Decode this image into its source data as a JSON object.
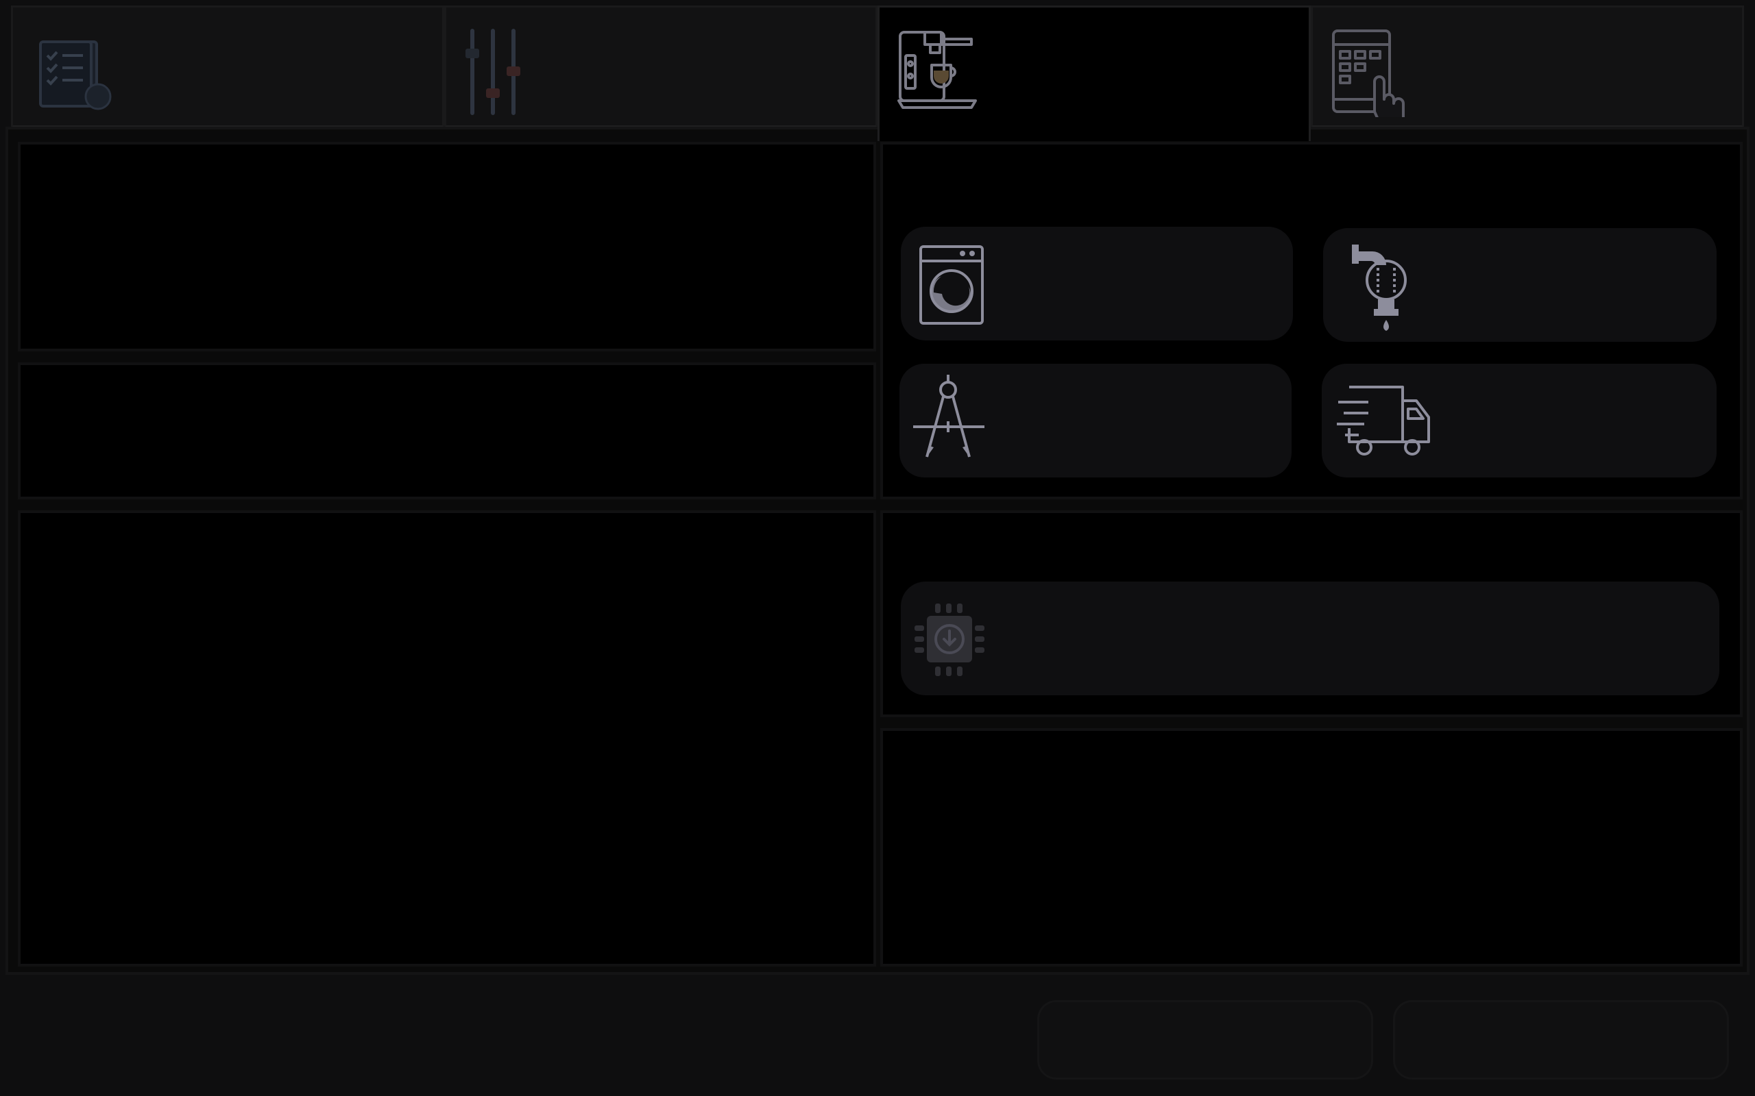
{
  "tabs": [
    {
      "icon": "checklist-document-icon",
      "active": false
    },
    {
      "icon": "sliders-icon",
      "active": false
    },
    {
      "icon": "coffee-machine-icon",
      "active": true
    },
    {
      "icon": "touch-screen-keypad-icon",
      "active": false
    }
  ],
  "sections": {
    "appliances": {
      "tiles": [
        {
          "icon": "washing-machine-icon"
        },
        {
          "icon": "water-filter-icon"
        },
        {
          "icon": "drafting-compass-icon"
        },
        {
          "icon": "delivery-truck-icon"
        }
      ]
    },
    "firmware": {
      "tiles": [
        {
          "icon": "firmware-chip-download-icon"
        }
      ]
    }
  },
  "footer": {
    "buttons": [
      {
        "id": "footer-button-1"
      },
      {
        "id": "footer-button-2"
      }
    ]
  },
  "colors": {
    "background": "#0e0e0f",
    "panel": "#000000",
    "tile": "#0f0f11",
    "icon_active": "#8d8d9c",
    "icon_dim": "#2e3440"
  }
}
